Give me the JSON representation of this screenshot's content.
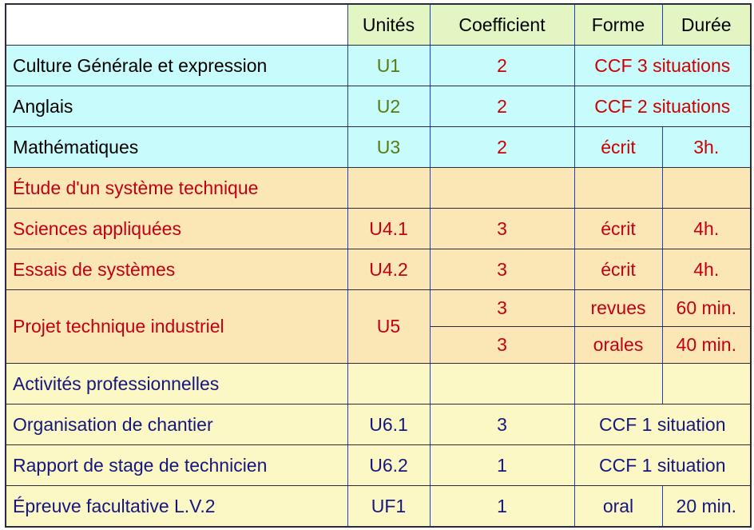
{
  "table": {
    "columns": [
      "",
      "Unités",
      "Coefficient",
      "Forme",
      "Durée"
    ],
    "headers": {
      "blank": "",
      "unites": "Unités",
      "coefficient": "Coefficient",
      "forme": "Forme",
      "duree": "Durée"
    },
    "sections": [
      {
        "id": "general",
        "color": "#c8fbfb",
        "rows": [
          {
            "label": "Culture Générale et expression",
            "unit": "U1",
            "coef": "2",
            "forme": "CCF 3 situations",
            "duree": ""
          },
          {
            "label": "Anglais",
            "unit": "U2",
            "coef": "2",
            "forme": "CCF 2 situations",
            "duree": ""
          },
          {
            "label": "Mathématiques",
            "unit": "U3",
            "coef": "2",
            "forme": "écrit",
            "duree": "3h."
          }
        ]
      },
      {
        "id": "etude",
        "color": "#fbe6b6",
        "title": "Étude d'un système technique",
        "rows": [
          {
            "label": "Sciences appliquées",
            "unit": "U4.1",
            "coef": "3",
            "forme": "écrit",
            "duree": "4h."
          },
          {
            "label": "Essais de systèmes",
            "unit": "U4.2",
            "coef": "3",
            "forme": "écrit",
            "duree": "4h."
          }
        ]
      },
      {
        "id": "projet",
        "color": "#fbe6b6",
        "label": "Projet technique industriel",
        "unit": "U5",
        "subrows": [
          {
            "coef": "3",
            "forme": "revues",
            "duree": "60 min."
          },
          {
            "coef": "3",
            "forme": "orales",
            "duree": "40 min."
          }
        ]
      },
      {
        "id": "activites",
        "color": "#fbf8c6",
        "title": "Activités professionnelles",
        "rows": [
          {
            "label": "Organisation de chantier",
            "unit": "U6.1",
            "coef": "3",
            "forme": "CCF 1 situation",
            "duree": ""
          },
          {
            "label": "Rapport de stage de technicien",
            "unit": "U6.2",
            "coef": "1",
            "forme": "CCF 1 situation",
            "duree": ""
          },
          {
            "label": "Épreuve facultative L.V.2",
            "unit": "UF1",
            "coef": "1",
            "forme": "oral",
            "duree": "20 min."
          }
        ]
      }
    ]
  },
  "colors": {
    "header_bg": "#e2f5c2",
    "cyan_bg": "#c8fbfb",
    "tan_bg": "#fbe6b6",
    "yellow_bg": "#fbf8c6",
    "red_text": "#c20014",
    "navy_text": "#161680",
    "olive_text": "#587c10",
    "grid_blue": "#1c3fcf",
    "grid_dark": "#2b2b3b"
  }
}
